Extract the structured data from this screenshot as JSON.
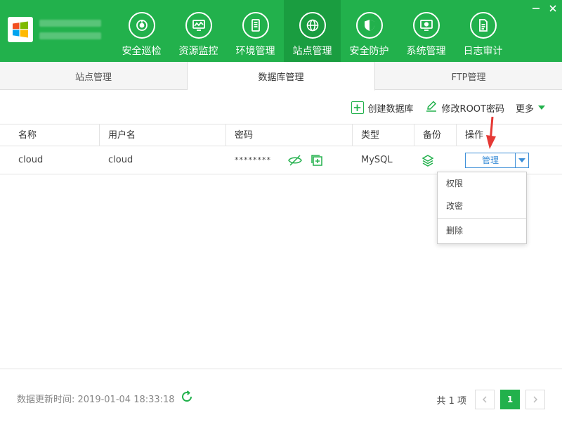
{
  "header": {
    "nav": [
      {
        "label": "安全巡检",
        "icon": "scan-icon"
      },
      {
        "label": "资源监控",
        "icon": "monitor-icon"
      },
      {
        "label": "环境管理",
        "icon": "server-icon"
      },
      {
        "label": "站点管理",
        "icon": "globe-icon",
        "active": true
      },
      {
        "label": "安全防护",
        "icon": "shield-icon"
      },
      {
        "label": "系统管理",
        "icon": "settings-icon"
      },
      {
        "label": "日志审计",
        "icon": "log-icon"
      }
    ],
    "brand_color": "#22b14c"
  },
  "tabs": [
    {
      "label": "站点管理"
    },
    {
      "label": "数据库管理",
      "active": true
    },
    {
      "label": "FTP管理"
    }
  ],
  "toolbar": {
    "create_db": "创建数据库",
    "change_root": "修改ROOT密码",
    "more": "更多"
  },
  "table": {
    "headers": [
      "名称",
      "用户名",
      "密码",
      "类型",
      "备份",
      "操作"
    ],
    "rows": [
      {
        "name": "cloud",
        "username": "cloud",
        "password": "********",
        "type": "MySQL",
        "action": "管理"
      }
    ]
  },
  "dropdown": {
    "items": [
      "权限",
      "改密",
      "删除"
    ]
  },
  "footer": {
    "update_label": "数据更新时间: 2019-01-04 18:33:18",
    "total": "共 1 项",
    "current_page": "1"
  },
  "colors": {
    "accent": "#22b14c",
    "link": "#3d8fd8",
    "arrow": "#e53935"
  }
}
